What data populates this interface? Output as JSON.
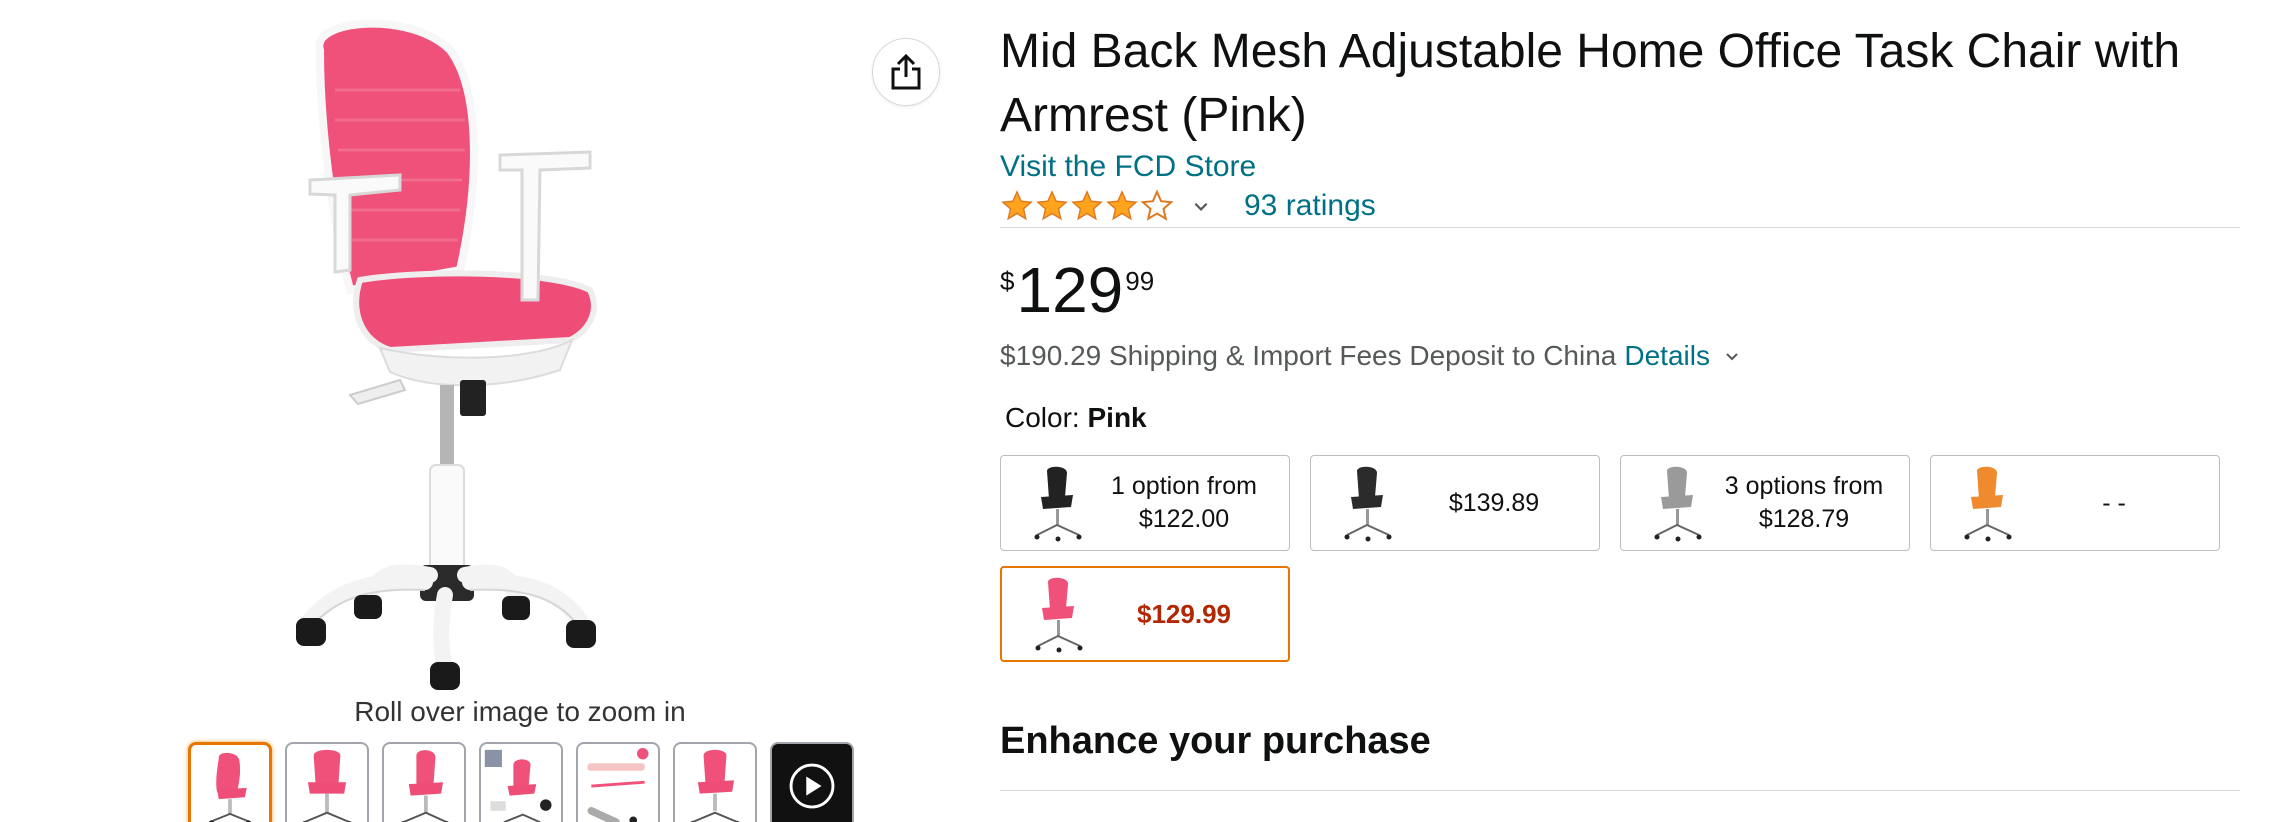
{
  "colors": {
    "link": "#007185",
    "star": "#ffa41c",
    "selected_border": "#e77600",
    "price_red": "#b12704",
    "chair_pink": "#f0517a"
  },
  "gallery": {
    "share_icon": "share-icon",
    "zoom_hint": "Roll over image to zoom in",
    "thumbnails": [
      {
        "kind": "image",
        "selected": true
      },
      {
        "kind": "image",
        "selected": false
      },
      {
        "kind": "image",
        "selected": false
      },
      {
        "kind": "image",
        "selected": false
      },
      {
        "kind": "image",
        "selected": false
      },
      {
        "kind": "image",
        "selected": false
      },
      {
        "kind": "video",
        "selected": false
      }
    ]
  },
  "product": {
    "title": "Mid Back Mesh Adjustable Home Office Task Chair with Armrest (Pink)",
    "store_link": "Visit the FCD Store",
    "rating_stars": 4,
    "ratings_count": "93 ratings",
    "price_symbol": "$",
    "price_whole": "129",
    "price_fraction": "99",
    "shipping_text": "$190.29 Shipping & Import Fees Deposit to China",
    "shipping_details": "Details"
  },
  "color_selector": {
    "label": "Color:",
    "selected_value": "Pink",
    "options": [
      {
        "price_text": "1 option from $122.00",
        "line1": "1 option from",
        "line2": "$122.00",
        "chair_color": "#222222"
      },
      {
        "price_text": "$139.89",
        "line1": "$139.89",
        "line2": "",
        "chair_color": "#2b2b2b"
      },
      {
        "price_text": "3 options from $128.79",
        "line1": "3 options from",
        "line2": "$128.79",
        "chair_color": "#9a9a9a"
      },
      {
        "price_text": "- -",
        "line1": "- -",
        "line2": "",
        "chair_color": "#f08a2e"
      },
      {
        "price_text": "$129.99",
        "line1": "$129.99",
        "line2": "",
        "chair_color": "#f0517a",
        "selected": true
      }
    ]
  },
  "enhance": {
    "heading": "Enhance your purchase"
  }
}
